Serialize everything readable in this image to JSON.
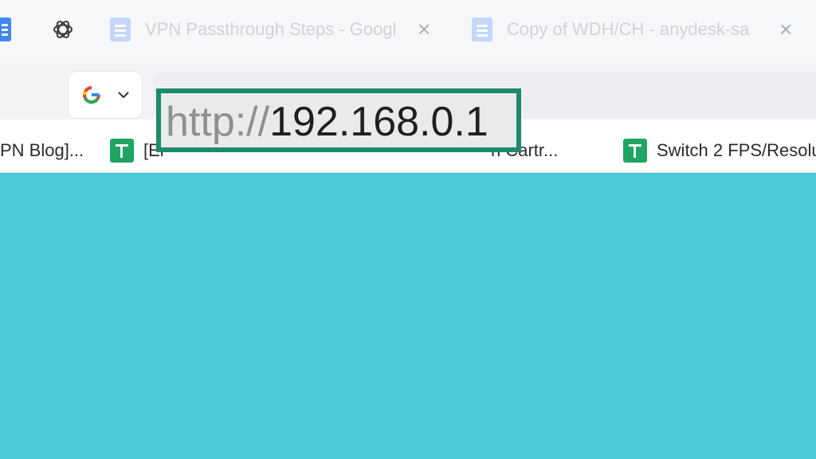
{
  "tabs": [
    {
      "title": "VPN Passthrough Steps - Googl",
      "icon": "google-docs-icon"
    },
    {
      "title": "Copy of WDH/CH - anydesk-sa",
      "icon": "google-docs-icon"
    }
  ],
  "tab_close_glyph": "×",
  "address_bar": {
    "url_scheme": "http://",
    "url_host": "192.168.0.1",
    "search_engine_icon": "google-icon"
  },
  "bookmarks": [
    {
      "label": "PN Blog]...",
      "icon": ""
    },
    {
      "label": "[Ei",
      "icon": "google-sheets-icon"
    },
    {
      "label": "h Cartr...",
      "icon": "google-sheets-icon"
    },
    {
      "label": "Switch 2 FPS/Resolu",
      "icon": "google-sheets-icon"
    }
  ],
  "colors": {
    "highlight_border": "#1d8a6a",
    "page_background": "#4bc9d6",
    "sheets_green": "#1fa463",
    "docs_blue": "#4285f4"
  }
}
